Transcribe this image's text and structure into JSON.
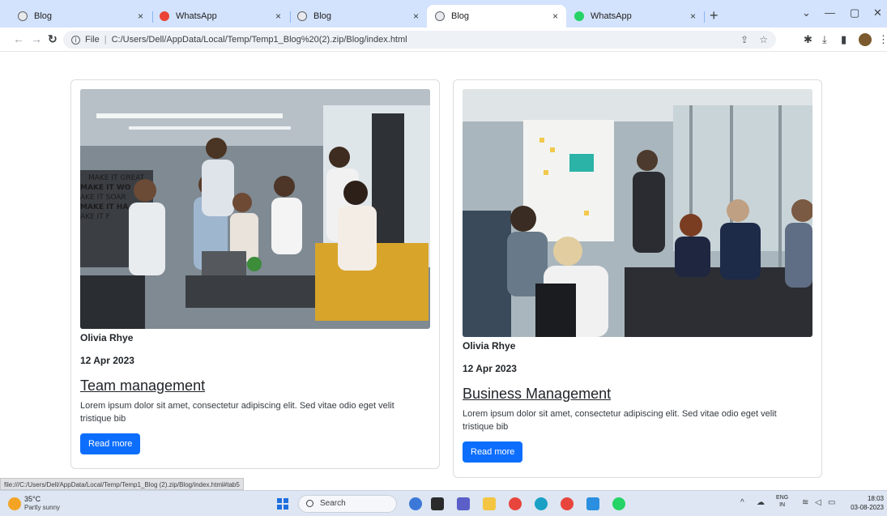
{
  "browser": {
    "tabs": [
      {
        "title": "Blog",
        "icon": "globe-icon",
        "active": false
      },
      {
        "title": "WhatsApp",
        "icon": "whatsapp-icon",
        "active": false
      },
      {
        "title": "Blog",
        "icon": "globe-icon",
        "active": false
      },
      {
        "title": "Blog",
        "icon": "globe-icon",
        "active": true
      },
      {
        "title": "WhatsApp",
        "icon": "whatsapp-icon",
        "active": false
      }
    ],
    "new_tab": "+",
    "close_glyph": "×",
    "address_scheme": "File",
    "address_url": "C:/Users/Dell/AppData/Local/Temp/Temp1_Blog%20(2).zip/Blog/index.html",
    "status_url": "file:///C:/Users/Dell/AppData/Local/Temp/Temp1_Blog (2).zip/Blog/index.html#tab5"
  },
  "posts": [
    {
      "author": "Olivia Rhye",
      "date": "12 Apr 2023",
      "title": "Team management",
      "excerpt": "Lorem ipsum dolor sit amet, consectetur adipiscing elit. Sed vitae odio eget velit tristique bib",
      "button": "Read more"
    },
    {
      "author": "Olivia Rhye",
      "date": "12 Apr 2023",
      "title": "Business Management",
      "excerpt": "Lorem ipsum dolor sit amet, consectetur adipiscing elit. Sed vitae odio eget velit tristique bib",
      "button": "Read more"
    }
  ],
  "poster_text": [
    "MAKE IT GREAT",
    "MAKE IT WO",
    "AKE IT SOAR",
    "MAKE IT HA",
    "AKE IT F"
  ],
  "taskbar": {
    "weather_temp": "35°C",
    "weather_desc": "Partly sunny",
    "search": "Search",
    "lang_top": "ENG",
    "lang_bottom": "IN",
    "time": "18:03",
    "date": "03-08-2023"
  },
  "colors": {
    "primary_button": "#0d6efd",
    "tabstrip": "#d3e3fd"
  }
}
